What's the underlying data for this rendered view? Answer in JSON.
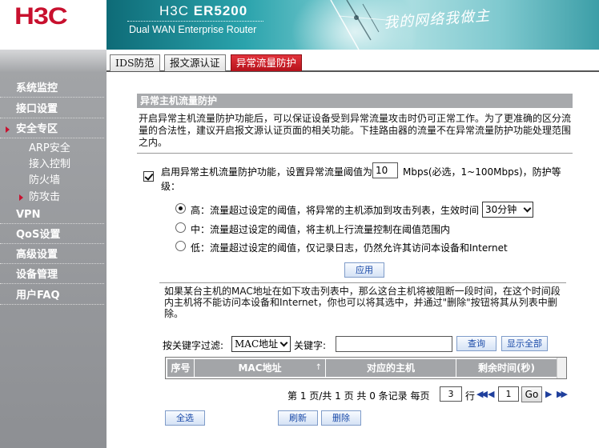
{
  "brand": {
    "logo": "H3C",
    "product_name": "H3C",
    "product_model": "ER5200",
    "product_sub": "Dual WAN Enterprise Router",
    "slogan": "我的网络我做主"
  },
  "colors": {
    "brand_red": "#c8102e",
    "sidebar_gray": "#9a9c9f",
    "header_teal": "#2aa3ac",
    "table_header_gray": "#a3a5a8",
    "link_blue": "#1a4aa8"
  },
  "nav": {
    "items": [
      {
        "label": "系统监控"
      },
      {
        "label": "接口设置"
      },
      {
        "label": "安全专区"
      },
      {
        "label": "VPN"
      },
      {
        "label": "QoS设置"
      },
      {
        "label": "高级设置"
      },
      {
        "label": "设备管理"
      },
      {
        "label": "用户FAQ"
      }
    ],
    "sub_items": [
      {
        "label": "ARP安全"
      },
      {
        "label": "接入控制"
      },
      {
        "label": "防火墙"
      },
      {
        "label": "防攻击"
      }
    ]
  },
  "tabs": [
    {
      "label": "IDS防范"
    },
    {
      "label": "报文源认证"
    },
    {
      "label": "异常流量防护"
    }
  ],
  "section": {
    "title": "异常主机流量防护",
    "description": "开启异常主机流量防护功能后，可以保证设备受到异常流量攻击时仍可正常工作。为了更准确的区分流量的合法性，建议开启报文源认证页面的相关功能。下挂路由器的流量不在异常流量防护功能处理范围之内。"
  },
  "enable": {
    "text_before": "启用异常主机流量防护功能，设置异常流量阈值为",
    "threshold": "10",
    "text_after": "Mbps(必选，1~100Mbps)，防护等",
    "text_wrap": "级："
  },
  "levels": {
    "high": "高：流量超过设定的阈值，将异常的主机添加到攻击列表，生效时间",
    "high_duration": "30分钟",
    "medium": "中：流量超过设定的阈值，将主机上行流量控制在阈值范围内",
    "low": "低：流量超过设定的阈值，仅记录日志，仍然允许其访问本设备和Internet"
  },
  "apply_label": "应用",
  "attack_list": {
    "description": "如果某台主机的MAC地址在如下攻击列表中，那么这台主机将被阻断一段时间，在这个时间段内主机将不能访问本设备和Internet，你也可以将其选中，并通过\"删除\"按钮将其从列表中删除。",
    "filter_label": "按关键字过滤:",
    "filter_option": "MAC地址",
    "keyword_label": "关键字:",
    "keyword_value": "",
    "query_label": "查询",
    "show_all_label": "显示全部",
    "columns": [
      "序号",
      "MAC地址",
      "对应的主机",
      "剩余时间(秒)"
    ],
    "sort_indicator": "↑"
  },
  "pager": {
    "text": "第 1 页/共 1 页 共 0 条记录 每页",
    "per_page": "3",
    "row_unit": "行",
    "goto_page": "1",
    "go_label": "Go"
  },
  "actions": {
    "select_all": "全选",
    "refresh": "刷新",
    "delete": "删除"
  }
}
